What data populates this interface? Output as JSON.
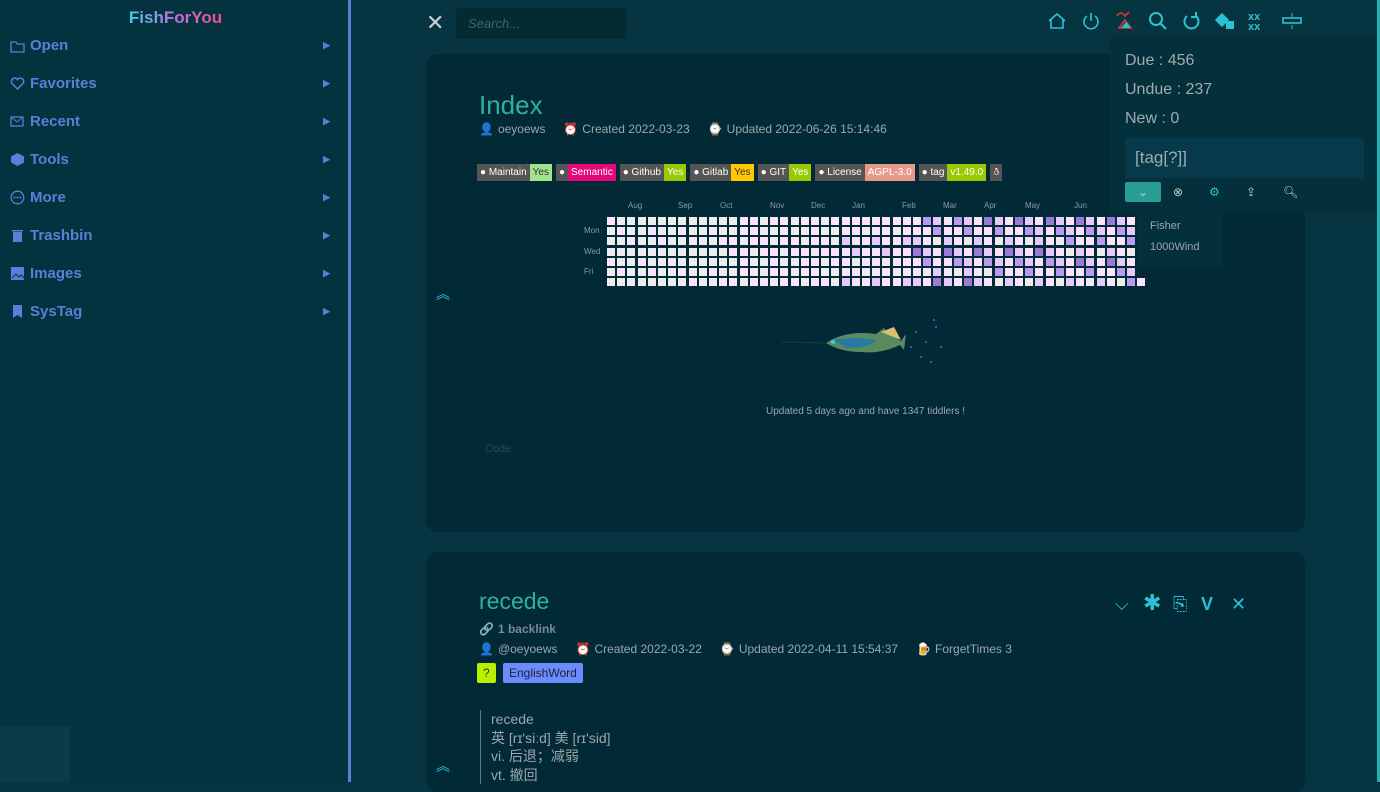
{
  "sidebar": {
    "brand": "FishForYou",
    "items": [
      {
        "label": "Open",
        "icon": "folder-open-icon"
      },
      {
        "label": "Favorites",
        "icon": "heart-icon"
      },
      {
        "label": "Recent",
        "icon": "mail-clock-icon"
      },
      {
        "label": "Tools",
        "icon": "tools-icon"
      },
      {
        "label": "More",
        "icon": "more-circle-icon"
      },
      {
        "label": "Trashbin",
        "icon": "trash-icon"
      },
      {
        "label": "Images",
        "icon": "image-icon"
      },
      {
        "label": "SysTag",
        "icon": "bookmark-icon"
      }
    ],
    "accent": "#5b7fd8"
  },
  "topbar": {
    "search_placeholder": "Search...",
    "icons": [
      "home-icon",
      "power-icon",
      "fish-hook-icon",
      "search-more-icon",
      "refresh-icon",
      "dice-icon",
      "grid-x-icon",
      "layout-icon"
    ],
    "accent": "#2bc3d4"
  },
  "index": {
    "title": "Index",
    "author": "oeyoews",
    "created": "Created 2022-03-23",
    "updated": "Updated 2022-06-26 15:14:46",
    "badges": [
      {
        "label": "Maintain",
        "value": "Yes",
        "color": "#a2e38f",
        "text": "#333"
      },
      {
        "label": "",
        "value": "Semantic",
        "color": "#e5087a",
        "text": "#fff"
      },
      {
        "label": "Github",
        "value": "Yes",
        "color": "#97ca00",
        "text": "#fff"
      },
      {
        "label": "Gitlab",
        "value": "Yes",
        "color": "#ffc800",
        "text": "#333"
      },
      {
        "label": "GIT",
        "value": "Yes",
        "color": "#97ca00",
        "text": "#fff"
      },
      {
        "label": "License",
        "value": "AGPL-3.0",
        "color": "#e89a8a",
        "text": "#fff"
      },
      {
        "label": "tag",
        "value": "v1.49.0",
        "color": "#97ca00",
        "text": "#fff"
      }
    ],
    "heatmap": {
      "months": [
        "Aug",
        "Sep",
        "Oct",
        "Nov",
        "Dec",
        "Jan",
        "Feb",
        "Mar",
        "Apr",
        "May",
        "Jun"
      ],
      "days": [
        "Mon",
        "Wed",
        "Fri"
      ],
      "weeks": 53,
      "colors": [
        "#ececec",
        "#fce3fc",
        "#e6c8fa",
        "#b99af0",
        "#9a7ad8"
      ]
    },
    "footer": "Updated 5 days ago and have 1347 tiddlers !",
    "code_label": "Code"
  },
  "review": {
    "due": "Due : 456",
    "undue": "Undue : 237",
    "new": "New : 0",
    "filter": "[tag[?]]",
    "suggestions": [
      "Fisher",
      "1000Wind"
    ]
  },
  "recede": {
    "title": "recede",
    "backlinks": "1 backlink",
    "author": "@oeyoews",
    "created": "Created 2022-03-22",
    "updated": "Updated 2022-04-11 15:54:37",
    "forget": "ForgetTimes 3",
    "tags": [
      {
        "label": "?",
        "color": "#b8f000"
      },
      {
        "label": "EnglishWord",
        "color": "#6a8cff"
      }
    ],
    "lines": [
      "recede",
      "英 [rɪ'siːd] 美 [rɪ'sid]",
      "vi. 后退；减弱",
      "vt. 撤回"
    ]
  }
}
